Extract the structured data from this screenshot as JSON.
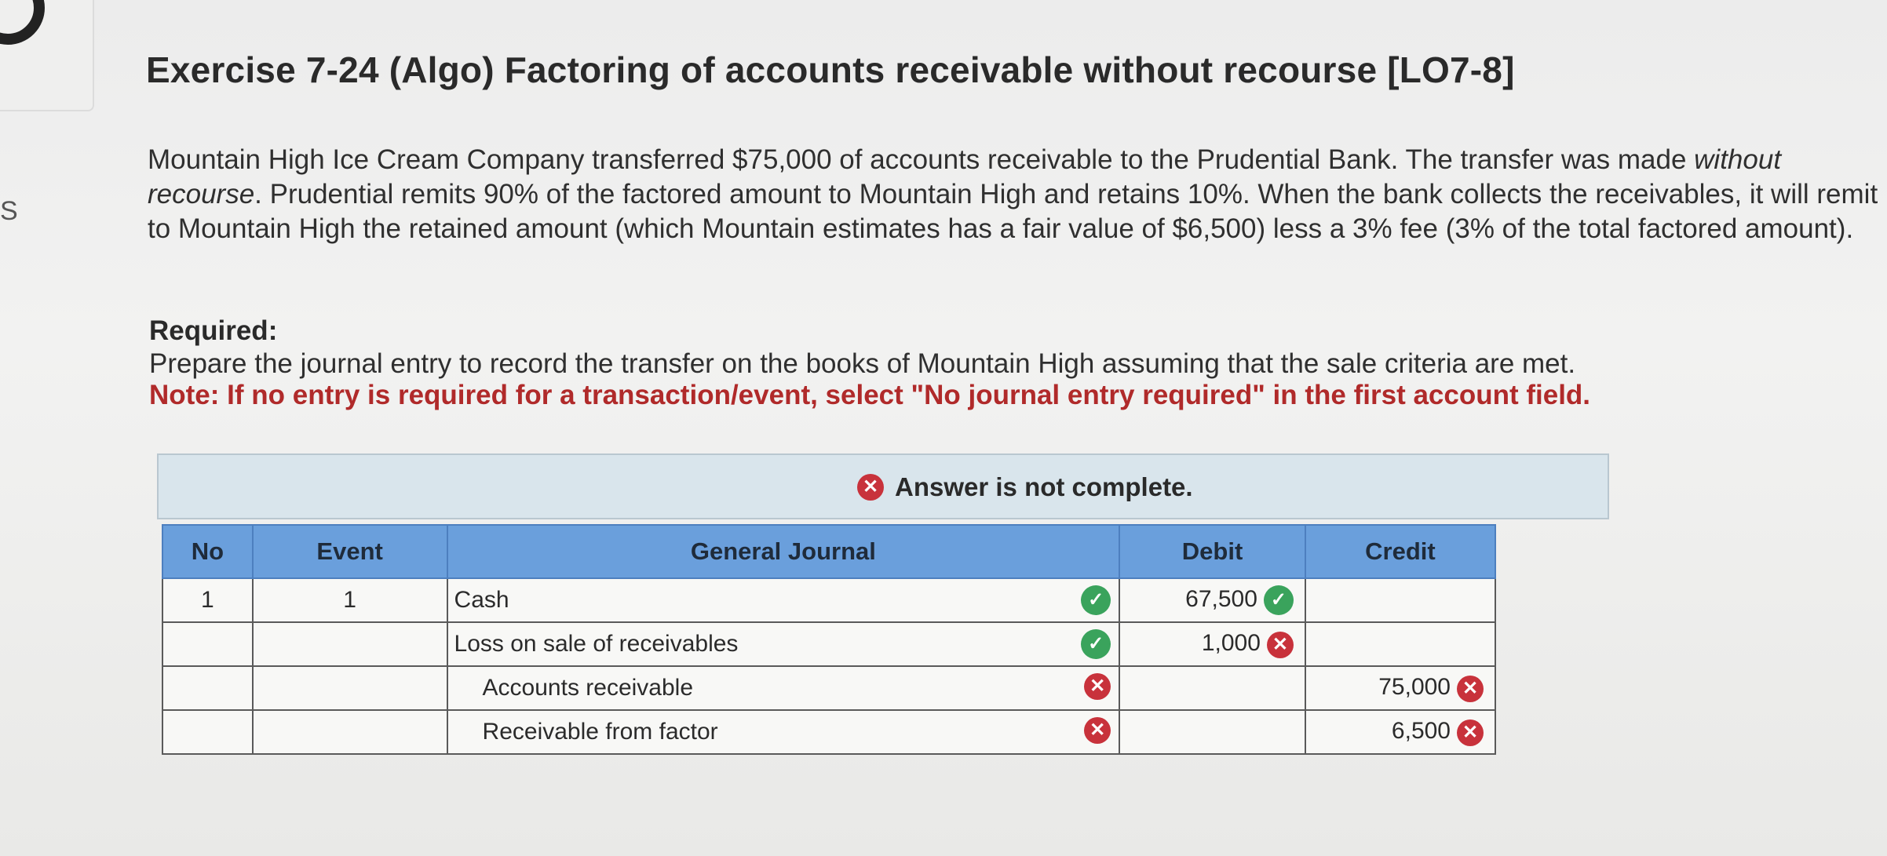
{
  "sidebar": {
    "letter": "S"
  },
  "exercise": {
    "title": "Exercise 7-24 (Algo) Factoring of accounts receivable without recourse [LO7-8]",
    "para_1": "Mountain High Ice Cream Company transferred $75,000 of accounts receivable to the Prudential Bank. The transfer was made ",
    "para_italic_1": "without recourse",
    "para_2": ". Prudential remits 90% of the factored amount to Mountain High and retains 10%. When the bank collects the receivables, it will remit to Mountain High the retained amount (which Mountain estimates has a fair value of $6,500) less a 3% fee (3% of the total factored amount).",
    "required_label": "Required:",
    "required_text": "Prepare the journal entry to record the transfer on the books of Mountain High assuming that the sale criteria are met.",
    "note": "Note: If no entry is required for a transaction/event, select \"No journal entry required\" in the first account field."
  },
  "banner": {
    "text": "Answer is not complete."
  },
  "table": {
    "headers": {
      "no": "No",
      "event": "Event",
      "journal": "General Journal",
      "debit": "Debit",
      "credit": "Credit"
    },
    "rows": [
      {
        "no": "1",
        "event": "1",
        "account": "Cash",
        "account_status": "correct",
        "debit": "67,500",
        "debit_status": "correct",
        "credit": "",
        "credit_status": ""
      },
      {
        "no": "",
        "event": "",
        "account": "Loss on sale of receivables",
        "account_status": "correct",
        "debit": "1,000",
        "debit_status": "incorrect",
        "credit": "",
        "credit_status": ""
      },
      {
        "no": "",
        "event": "",
        "account": "Accounts receivable",
        "account_status": "incorrect",
        "debit": "",
        "debit_status": "",
        "credit": "75,000",
        "credit_status": "incorrect"
      },
      {
        "no": "",
        "event": "",
        "account": "Receivable from factor",
        "account_status": "incorrect",
        "debit": "",
        "debit_status": "",
        "credit": "6,500",
        "credit_status": "incorrect"
      }
    ]
  },
  "colors": {
    "correct": "#3aa35c",
    "incorrect": "#c8323b",
    "header": "#6a9fdc",
    "note": "#b02a2a"
  }
}
